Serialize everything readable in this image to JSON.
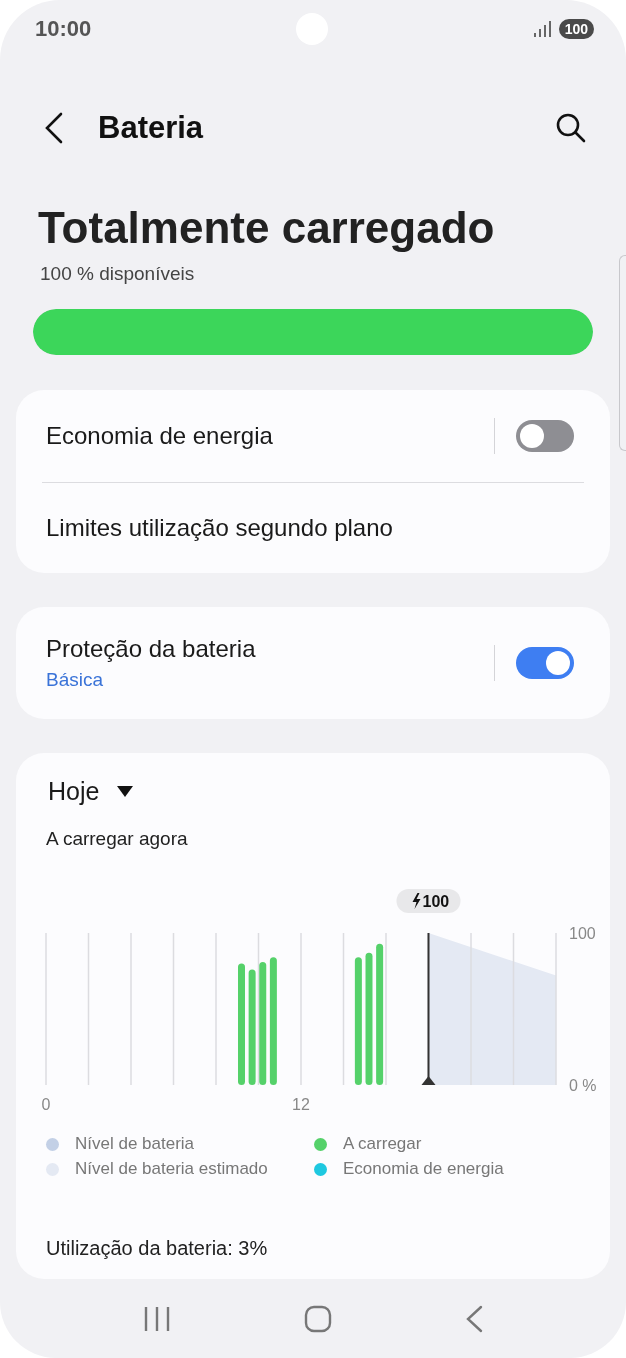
{
  "status_bar": {
    "time": "10:00",
    "battery": "100"
  },
  "header": {
    "title": "Bateria"
  },
  "summary": {
    "title": "Totalmente carregado",
    "subtitle": "100 % disponíveis",
    "level": 1
  },
  "settings_card": {
    "rows": [
      {
        "kind": "toggle",
        "label": "Economia de energia",
        "on": false
      },
      {
        "kind": "link",
        "label": "Limites utilização segundo plano"
      }
    ]
  },
  "protection_card": {
    "rows": [
      {
        "kind": "toggle",
        "label": "Proteção da bateria",
        "sublabel": "Básica",
        "on": true
      }
    ]
  },
  "usage_card": {
    "period": "Hoje",
    "status": "A carregar agora",
    "chart_data": {
      "type": "bar",
      "xlim": [
        0,
        24
      ],
      "ylim": [
        0,
        100
      ],
      "xticks": [
        {
          "value": 0,
          "label": "0"
        },
        {
          "value": 12,
          "label": "12"
        }
      ],
      "yticks": [
        {
          "value": 0,
          "label": "0 %"
        },
        {
          "value": 100,
          "label": "100"
        }
      ],
      "stacked": false,
      "x": [
        9.2,
        9.7,
        10.2,
        10.7,
        14.7,
        15.2,
        15.7
      ],
      "series": [
        {
          "color": "#55d16a",
          "values": [
            80,
            76,
            81,
            84,
            84,
            87,
            93
          ]
        }
      ],
      "ref_lines": [
        {
          "axis": "x",
          "value": 18
        }
      ],
      "annotations": [
        "100"
      ]
    },
    "legend": [
      {
        "label": "Nível de bateria",
        "color": "#c3d0e6"
      },
      {
        "label": "A carregar",
        "color": "#55d16a"
      },
      {
        "label": "Nível de bateria estimado",
        "color": "#e4e9f3"
      },
      {
        "label": "Economia de energia",
        "color": "#1ec8e0"
      }
    ],
    "usage_title": "Utilização da bateria: 3%"
  }
}
